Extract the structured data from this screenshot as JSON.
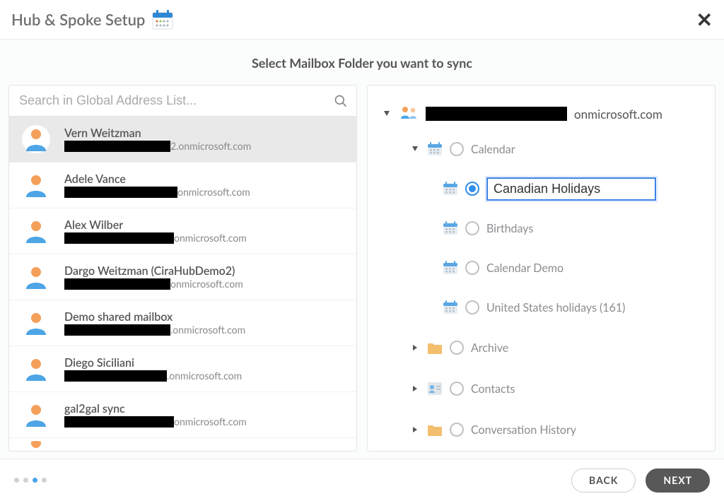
{
  "header": {
    "title": "Hub & Spoke Setup"
  },
  "instruction": "Select Mailbox Folder you want to sync",
  "search": {
    "placeholder": "Search in Global Address List..."
  },
  "people": [
    {
      "name": "Vern Weitzman",
      "redact_w": 150,
      "domain_tail": "2.onmicrosoft.com",
      "selected": true
    },
    {
      "name": "Adele Vance",
      "redact_w": 160,
      "domain_tail": "onmicrosoft.com",
      "selected": false
    },
    {
      "name": "Alex Wilber",
      "redact_w": 155,
      "domain_tail": "onmicrosoft.com",
      "selected": false
    },
    {
      "name": "Dargo Weitzman (CiraHubDemo2)",
      "redact_w": 150,
      "domain_tail": "onmicrosoft.com",
      "selected": false
    },
    {
      "name": "Demo shared mailbox",
      "redact_w": 150,
      "domain_tail": ".onmicrosoft.com",
      "selected": false
    },
    {
      "name": "Diego Siciliani",
      "redact_w": 145,
      "domain_tail": ".onmicrosoft.com",
      "selected": false
    },
    {
      "name": "gal2gal sync",
      "redact_w": 155,
      "domain_tail": "onmicrosoft.com",
      "selected": false
    }
  ],
  "tree": {
    "account_domain_tail": "onmicrosoft.com",
    "calendar": {
      "label": "Calendar",
      "editing_value": "Canadian Holidays",
      "subs": [
        {
          "label": "Birthdays"
        },
        {
          "label": "Calendar Demo"
        },
        {
          "label": "United States holidays (161)"
        }
      ]
    },
    "folders": [
      {
        "label": "Archive",
        "icon": "folder"
      },
      {
        "label": "Contacts",
        "icon": "contacts"
      },
      {
        "label": "Conversation History",
        "icon": "folder"
      }
    ]
  },
  "footer": {
    "back": "BACK",
    "next": "NEXT",
    "active_step_index": 2,
    "total_steps": 4
  }
}
